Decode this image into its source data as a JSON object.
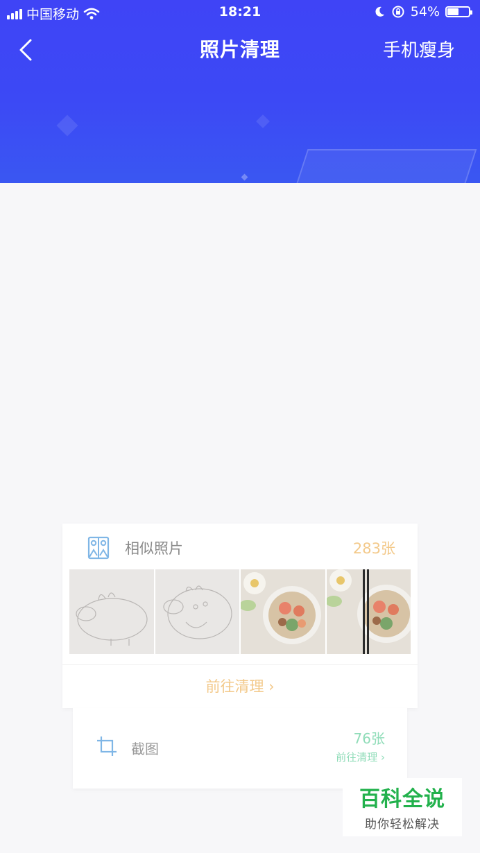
{
  "status_bar": {
    "carrier": "中国移动",
    "time": "18:21",
    "battery": "54%",
    "battery_level": 0.54
  },
  "nav": {
    "title": "照片清理",
    "right_action": "手机瘦身"
  },
  "similar_photos": {
    "label": "相似照片",
    "count": "283张",
    "goto": "前往清理 ›",
    "thumbnails": [
      "sketch-pig",
      "sketch-pig",
      "food-bowl",
      "food-bowl"
    ]
  },
  "screenshots": {
    "label": "截图",
    "count": "76张",
    "goto": "前往清理 ›"
  },
  "watermark": {
    "title": "百科全说",
    "subtitle": "助你轻松解决"
  },
  "colors": {
    "header": "#3f44f6",
    "accent_orange": "#f3c98a",
    "accent_green": "#8fdcb8",
    "watermark_green": "#22b14c"
  }
}
